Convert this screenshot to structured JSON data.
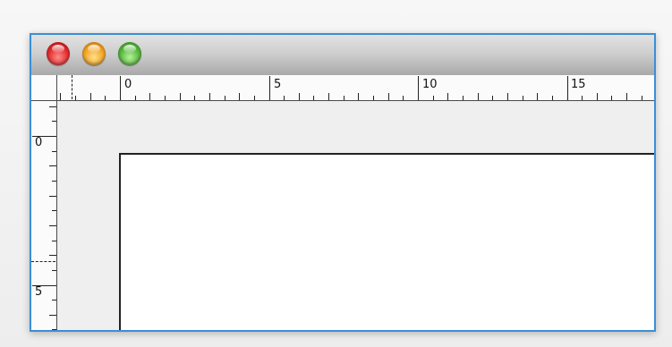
{
  "window": {
    "controls": [
      {
        "name": "close-button",
        "color": "#e02a2a"
      },
      {
        "name": "minimize-button",
        "color": "#f0a020"
      },
      {
        "name": "zoom-button",
        "color": "#52b43a"
      }
    ],
    "border_color": "#3a8fd6"
  },
  "rulers": {
    "horizontal": {
      "labels": [
        "0",
        "5",
        "10",
        "15"
      ]
    },
    "vertical": {
      "labels": [
        "0",
        "5"
      ]
    }
  }
}
